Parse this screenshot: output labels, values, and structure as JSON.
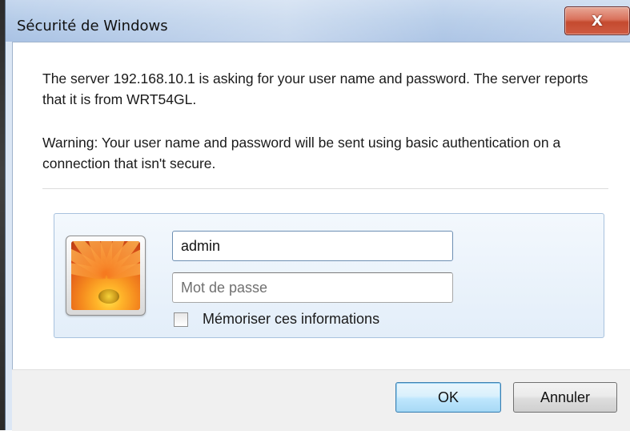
{
  "window": {
    "title": "Sécurité de Windows",
    "close_label": "X"
  },
  "message": {
    "text": "The server 192.168.10.1 is asking for your user name and password. The server reports that it is from WRT54GL.",
    "warning": "Warning: Your user name and password will be sent using basic authentication on a connection that isn't secure."
  },
  "credentials": {
    "avatar_icon": "user-avatar-flower-icon",
    "username_value": "admin",
    "password_placeholder": "Mot de passe",
    "remember_label": "Mémoriser ces informations",
    "remember_checked": false
  },
  "buttons": {
    "ok_label": "OK",
    "cancel_label": "Annuler"
  }
}
